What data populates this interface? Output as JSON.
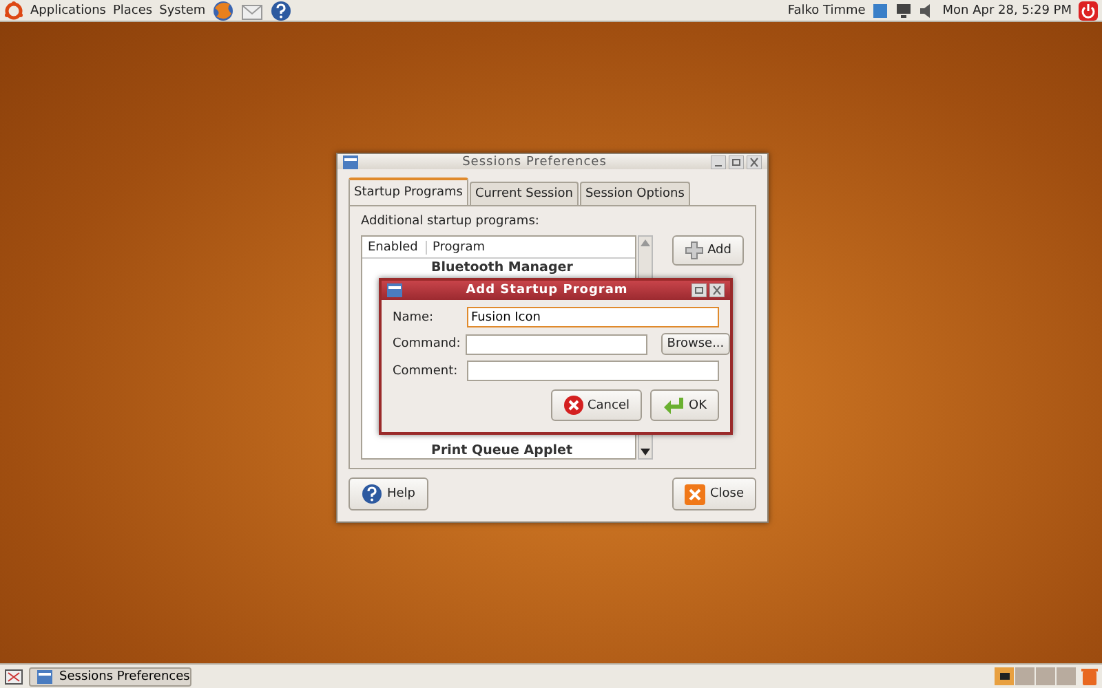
{
  "top_panel": {
    "menus": [
      "Applications",
      "Places",
      "System"
    ],
    "user": "Falko Timme",
    "clock": "Mon Apr 28,  5:29 PM"
  },
  "main_window": {
    "title": "Sessions Preferences",
    "tabs": [
      {
        "label": "Startup Programs",
        "selected": true
      },
      {
        "label": "Current Session",
        "selected": false
      },
      {
        "label": "Session Options",
        "selected": false
      }
    ],
    "list_label": "Additional startup programs:",
    "columns": [
      "Enabled",
      "Program"
    ],
    "programs": [
      "Bluetooth Manager",
      "Print Queue Applet"
    ],
    "add_button": "Add",
    "help_button": "Help",
    "close_button": "Close"
  },
  "dialog": {
    "title": "Add Startup Program",
    "fields": [
      {
        "label": "Name:",
        "value": "Fusion Icon",
        "focused": true
      },
      {
        "label": "Command:",
        "focused": false
      },
      {
        "label": "Comment:",
        "focused": false
      }
    ],
    "browse_button": "Browse...",
    "cancel_button": "Cancel",
    "ok_button": "OK"
  },
  "bottom_panel": {
    "task": "Sessions Preferences",
    "workspaces": [
      {
        "selected": true
      },
      {
        "selected": false
      },
      {
        "selected": false
      },
      {
        "selected": false
      }
    ]
  }
}
